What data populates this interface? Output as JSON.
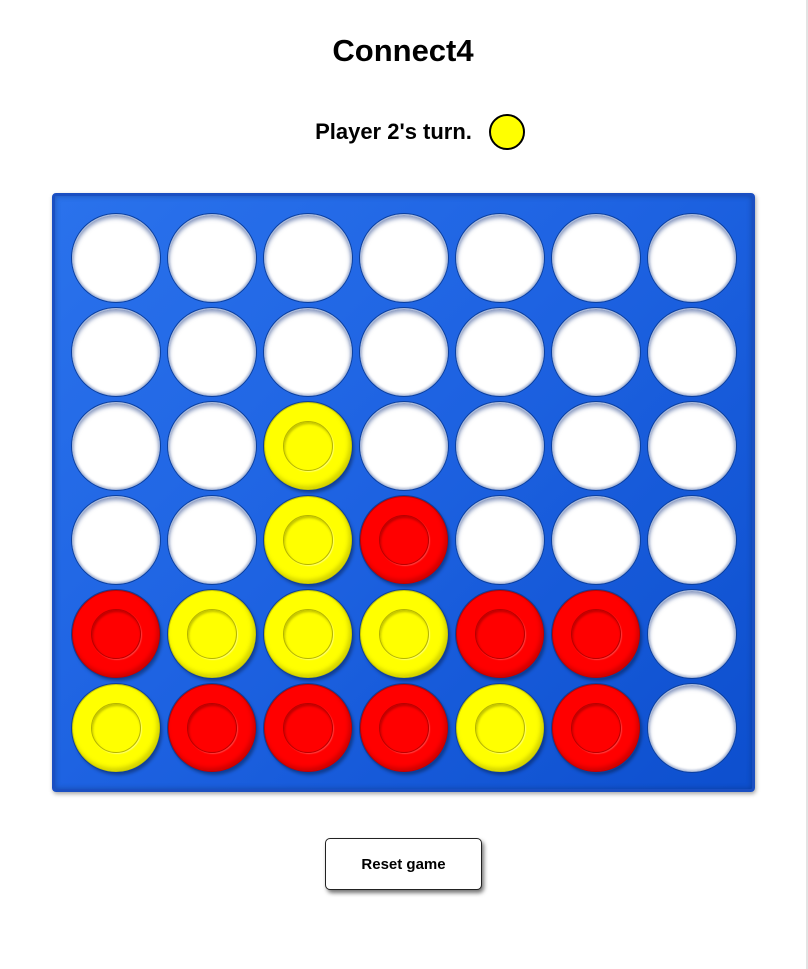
{
  "app": {
    "title": "Connect4"
  },
  "status": {
    "text": "Player 2's turn.",
    "current_player": 2,
    "current_color": "yellow"
  },
  "colors": {
    "board": "#1e63e2",
    "red": "#ff0000",
    "yellow": "#ffff00",
    "empty": "#ffffff"
  },
  "board": {
    "columns": 7,
    "rows": 6,
    "cells": [
      [
        "empty",
        "empty",
        "empty",
        "empty",
        "empty",
        "empty",
        "empty"
      ],
      [
        "empty",
        "empty",
        "empty",
        "empty",
        "empty",
        "empty",
        "empty"
      ],
      [
        "empty",
        "empty",
        "yellow",
        "empty",
        "empty",
        "empty",
        "empty"
      ],
      [
        "empty",
        "empty",
        "yellow",
        "red",
        "empty",
        "empty",
        "empty"
      ],
      [
        "red",
        "yellow",
        "yellow",
        "yellow",
        "red",
        "red",
        "empty"
      ],
      [
        "yellow",
        "red",
        "red",
        "red",
        "yellow",
        "red",
        "empty"
      ]
    ]
  },
  "controls": {
    "reset_label": "Reset game"
  }
}
